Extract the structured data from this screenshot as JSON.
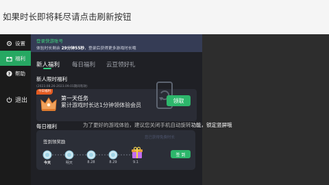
{
  "banner": {
    "text": "如果时长即将耗尽请点击刷新按钮"
  },
  "sidebar": {
    "items": [
      {
        "label": "设置",
        "icon": "gear-icon"
      },
      {
        "label": "福利",
        "icon": "gift-icon"
      },
      {
        "label": "帮助",
        "icon": "help-icon"
      }
    ],
    "exit_label": "退出"
  },
  "info": {
    "login_title": "登录快游账号",
    "remaining_prefix": "体验时长剩余 ",
    "remaining_value": "29分钟55秒",
    "remaining_suffix": "，登录后获得更多游戏时长哦"
  },
  "tabs": [
    "新人福利",
    "每日福利",
    "云豆领好礼"
  ],
  "newbie": {
    "title": "新人限时福利",
    "date_range": "(2023.08.26-2023.09.01期间有效)",
    "badge": "今日福利",
    "task_title": "第一天任务",
    "task_desc": "累计游戏时长达1分钟领体验会员",
    "claim_label": "领取"
  },
  "daily": {
    "title": "每日福利",
    "sign_title": "签到领奖励",
    "days": [
      "今天",
      "明天",
      "8.28",
      "8.29",
      "9.1"
    ],
    "sign_label": "签 到"
  },
  "toast": {
    "part1": "为了更好的游戏体验，建议您关闭手机自动旋转",
    "part2": "功能，锁定竖屏哦"
  },
  "faint_text": "您已获得免费时长",
  "colors": {
    "accent": "#2db66b",
    "badge": "#e25a21",
    "info_strip": "#353c55"
  }
}
